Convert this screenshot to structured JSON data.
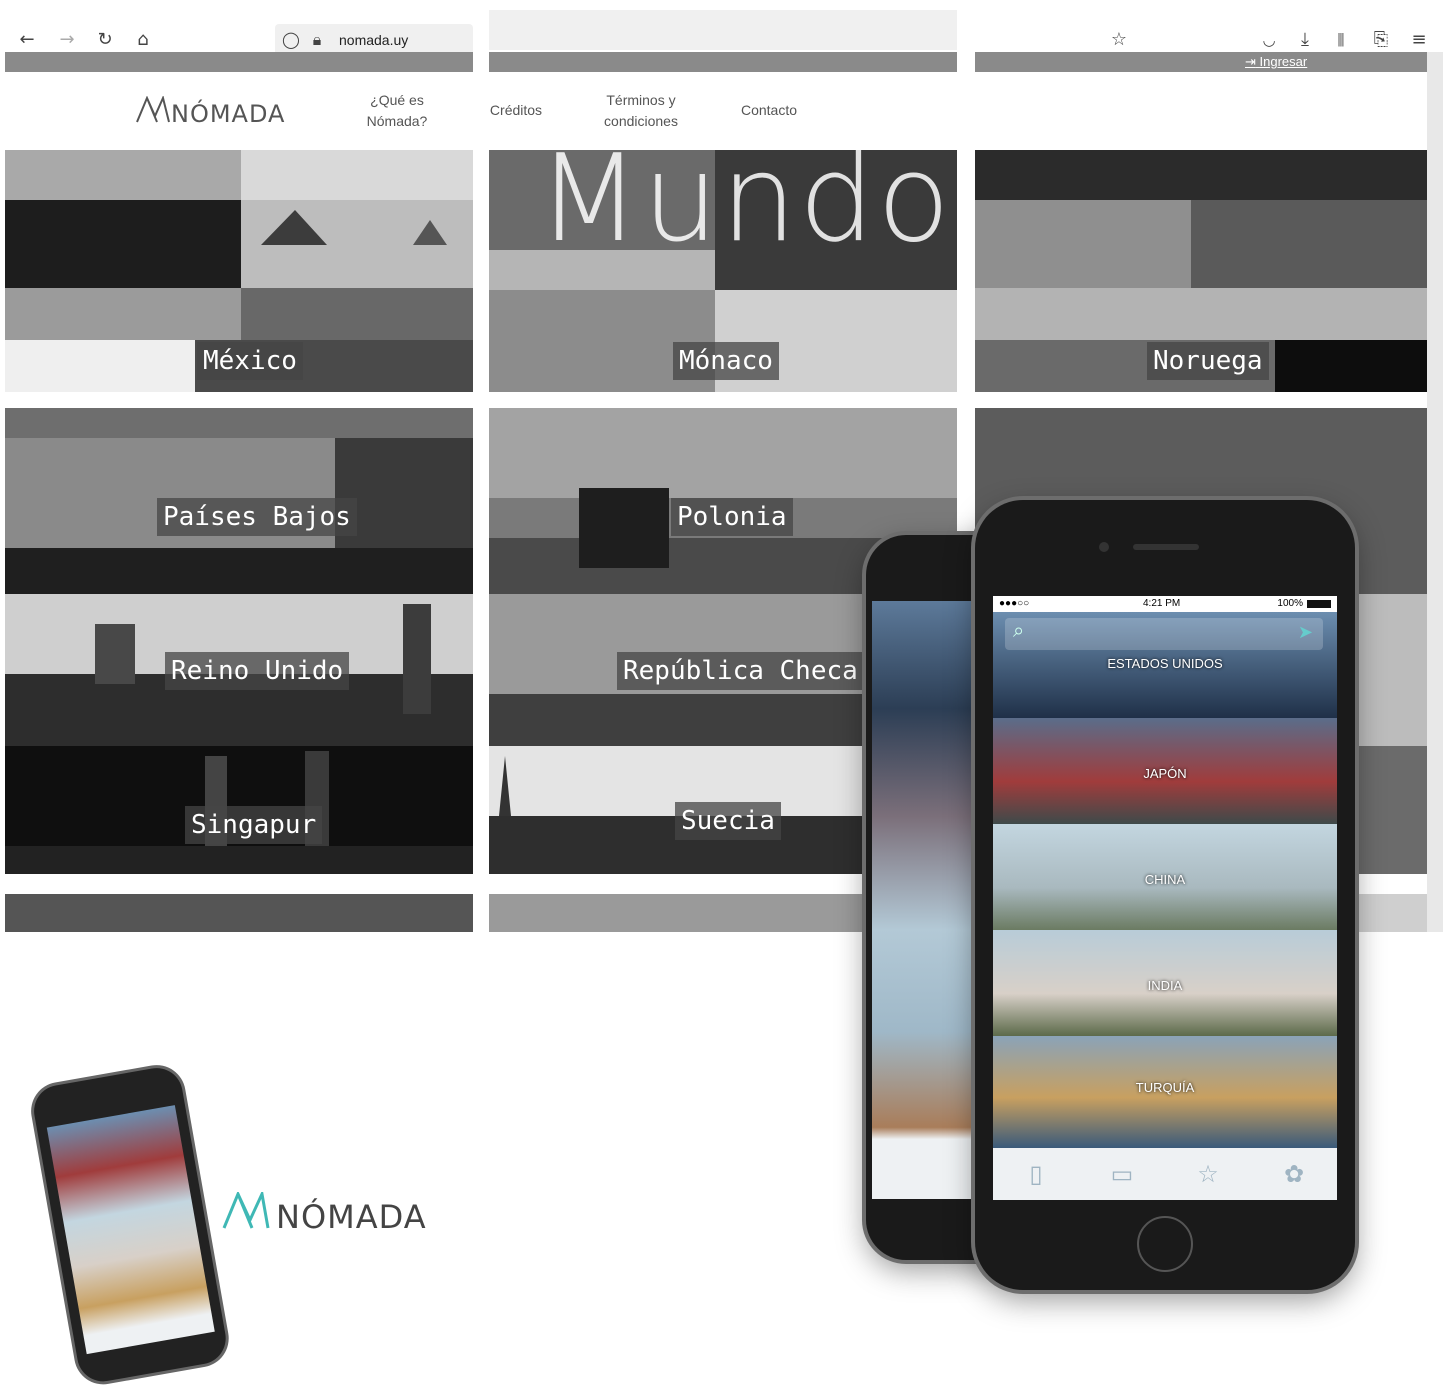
{
  "browser": {
    "url": "nomada.uy",
    "login": "Ingresar"
  },
  "nav": {
    "brand": "NÓMADA",
    "items": [
      {
        "line1": "¿Qué es",
        "line2": "Nómada?"
      },
      {
        "line1": "Créditos",
        "line2": ""
      },
      {
        "line1": "Términos y",
        "line2": "condiciones"
      },
      {
        "line1": "Contacto",
        "line2": ""
      }
    ]
  },
  "hero": {
    "word": "Mundo"
  },
  "countries": {
    "c1": "México",
    "c2": "Mónaco",
    "c3": "Noruega",
    "c4": "Países Bajos",
    "c5": "Polonia",
    "c6": "Reino Unido",
    "c7": "República Checa",
    "c8": "Singapur",
    "c9": "Suecia"
  },
  "app": {
    "status_time": "4:21 PM",
    "status_battery": "100%",
    "rows": [
      "ESTADOS UNIDOS",
      "JAPÓN",
      "CHINA",
      "INDIA",
      "TURQUÍA"
    ]
  },
  "brand_logo": "NÓMADA",
  "colors": {
    "accent": "#3fb8b5",
    "dark": "#1a1a1a"
  }
}
